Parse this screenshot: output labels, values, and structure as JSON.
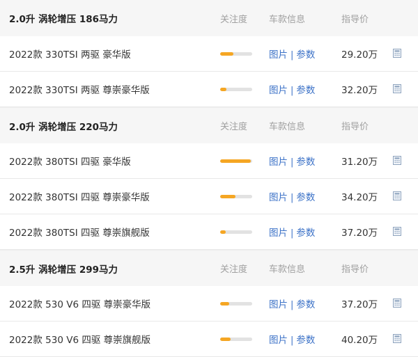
{
  "colors": {
    "accent_bar": "#f5a623",
    "link": "#3c72c7",
    "header_bg": "#f6f6f6"
  },
  "groups": [
    {
      "title": "2.0升 涡轮增压 186马力",
      "col_attention": "关注度",
      "col_info": "车款信息",
      "col_price": "指导价",
      "rows": [
        {
          "name": "2022款 330TSI 两驱 豪华版",
          "attention": 0.42,
          "photos_label": "图片",
          "params_label": "参数",
          "price": "29.20万",
          "icon": "calculator-icon"
        },
        {
          "name": "2022款 330TSI 两驱 尊崇豪华版",
          "attention": 0.2,
          "photos_label": "图片",
          "params_label": "参数",
          "price": "32.20万",
          "icon": "calculator-icon"
        }
      ]
    },
    {
      "title": "2.0升 涡轮增压 220马力",
      "col_attention": "关注度",
      "col_info": "车款信息",
      "col_price": "指导价",
      "rows": [
        {
          "name": "2022款 380TSI 四驱 豪华版",
          "attention": 0.95,
          "photos_label": "图片",
          "params_label": "参数",
          "price": "31.20万",
          "icon": "calculator-icon"
        },
        {
          "name": "2022款 380TSI 四驱 尊崇豪华版",
          "attention": 0.48,
          "photos_label": "图片",
          "params_label": "参数",
          "price": "34.20万",
          "icon": "calculator-icon"
        },
        {
          "name": "2022款 380TSI 四驱 尊崇旗舰版",
          "attention": 0.18,
          "photos_label": "图片",
          "params_label": "参数",
          "price": "37.20万",
          "icon": "calculator-icon"
        }
      ]
    },
    {
      "title": "2.5升 涡轮增压 299马力",
      "col_attention": "关注度",
      "col_info": "车款信息",
      "col_price": "指导价",
      "rows": [
        {
          "name": "2022款 530 V6 四驱 尊崇豪华版",
          "attention": 0.28,
          "photos_label": "图片",
          "params_label": "参数",
          "price": "37.20万",
          "icon": "calculator-icon"
        },
        {
          "name": "2022款 530 V6 四驱 尊崇旗舰版",
          "attention": 0.32,
          "photos_label": "图片",
          "params_label": "参数",
          "price": "40.20万",
          "icon": "calculator-icon"
        }
      ]
    }
  ]
}
